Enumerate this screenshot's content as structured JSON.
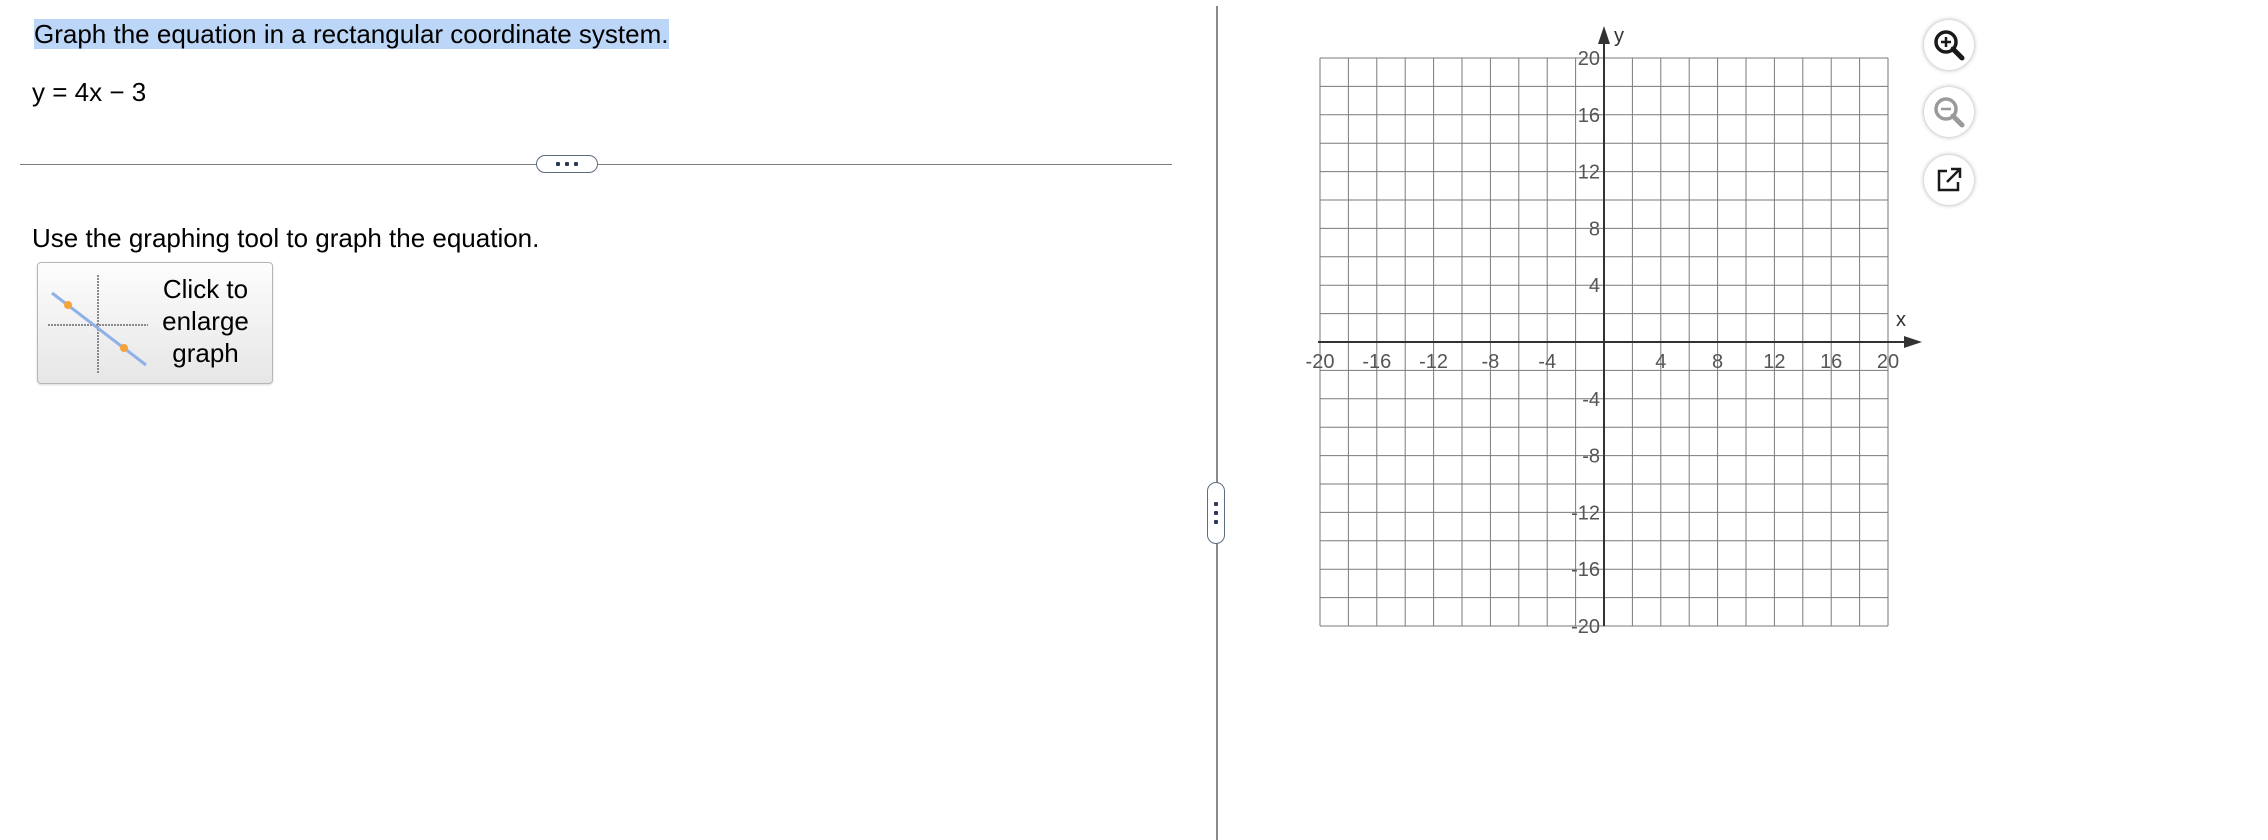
{
  "question": {
    "title": "Graph the equation in a rectangular coordinate system.",
    "equation": "y = 4x − 3"
  },
  "instruction": "Use the graphing tool to graph the equation.",
  "enlarge_button": {
    "line1": "Click to",
    "line2": "enlarge",
    "line3": "graph"
  },
  "graph": {
    "x_axis_label": "x",
    "y_axis_label": "y",
    "x_min": -20,
    "x_max": 20,
    "y_min": -20,
    "y_max": 20,
    "grid_step": 2,
    "tick_label_step": 4,
    "x_tick_labels": [
      "-20",
      "-16",
      "-12",
      "-8",
      "-4",
      "4",
      "8",
      "12",
      "16",
      "20"
    ],
    "y_tick_labels": [
      "20",
      "16",
      "12",
      "8",
      "4",
      "-4",
      "-8",
      "-12",
      "-16",
      "-20"
    ]
  },
  "tools": {
    "zoom_in": "zoom-in-icon",
    "zoom_out": "zoom-out-icon",
    "popout": "external-link-icon"
  },
  "colors": {
    "highlight": "#bcd6f7",
    "grid_line": "#7a7a7a",
    "zoom_in": "#1a1a1a",
    "zoom_out_disabled": "#9a9a9a"
  }
}
